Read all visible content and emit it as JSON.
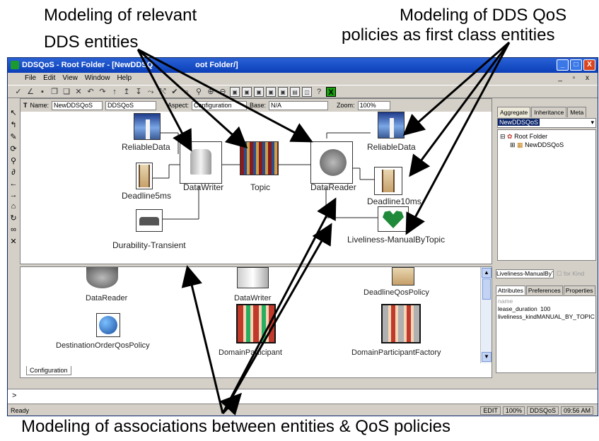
{
  "captions": {
    "top_left_1": "Modeling of relevant",
    "top_left_2": "DDS entities",
    "top_right_1": "Modeling of DDS QoS",
    "top_right_2": "policies as first class entities",
    "bottom": "Modeling of associations between entities & QoS policies"
  },
  "window": {
    "title": "DDSQoS - Root Folder - [NewDDSQoS - Root Folder/]",
    "title_visible": "DDSQoS - Root Folder - [NewDDSQ",
    "title_tail": "oot Folder/]",
    "buttons": {
      "minimize": "_",
      "maximize": "□",
      "close": "X"
    }
  },
  "menu": [
    "File",
    "Edit",
    "View",
    "Window",
    "Help"
  ],
  "mdi_controls": "_ ▫ x",
  "namebar": {
    "name_label": "Name:",
    "name_value": "NewDDSQoS",
    "type_value": "DDSQoS",
    "aspect_label": "Aspect:",
    "aspect_value": "Configuration",
    "base_label": "Base:",
    "base_value": "N/A",
    "zoom_label": "Zoom:",
    "zoom_value": "100%"
  },
  "canvas_labels": {
    "reliable_left": "ReliableData",
    "deadline5": "Deadline5ms",
    "datawriter": "DataWriter",
    "topic": "Topic",
    "datareader": "DataReader",
    "reliable_right": "ReliableData",
    "deadline10": "Deadline10ms",
    "durability": "Durability-Transient",
    "liveliness": "Liveliness-ManualByTopic"
  },
  "right_panel": {
    "tabs": [
      "Aggregate",
      "Inheritance",
      "Meta"
    ],
    "selected": "NewDDSQoS",
    "tree": [
      "Root Folder",
      "NewDDSQoS"
    ]
  },
  "bottom_panel": {
    "items": [
      "DataReader",
      "DataWriter",
      "DeadlineQosPolicy",
      "DestinationOrderQosPolicy",
      "DomainParticipant",
      "DomainParticipantFactory"
    ],
    "tab": "Configuration"
  },
  "attributes": {
    "selector": "Liveliness-ManualByTopi",
    "for_kind": "for Kind",
    "tabs": [
      "Attributes",
      "Preferences",
      "Properties"
    ],
    "header": "name",
    "rows": [
      {
        "k": "lease_duration",
        "v": "100"
      },
      {
        "k": "liveliness_kind",
        "v": "MANUAL_BY_TOPIC"
      }
    ]
  },
  "console": {
    "prompt": ">"
  },
  "status": {
    "left": "Ready",
    "cells": [
      "EDIT",
      "100%",
      "DDSQoS",
      "09:56 AM"
    ]
  },
  "colors": {
    "titlebar": "#0b3fb8",
    "accent_green": "#16a20b"
  }
}
